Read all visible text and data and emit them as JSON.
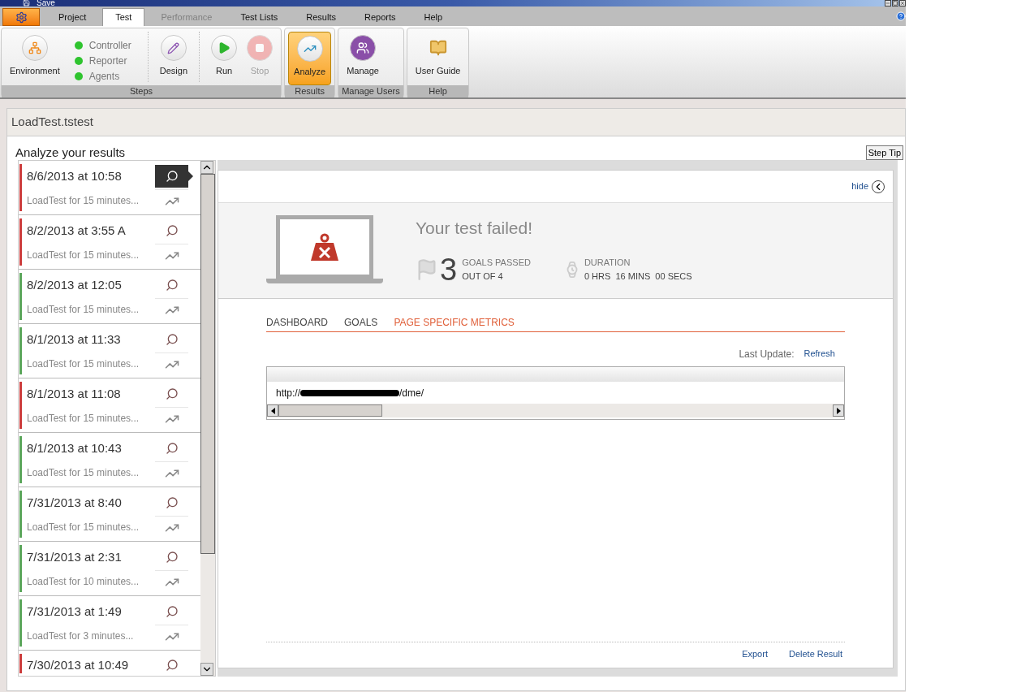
{
  "quick_access": {
    "label": "Save"
  },
  "menu_tabs": [
    {
      "label": "Project",
      "selected": false,
      "disabled": false
    },
    {
      "label": "Test",
      "selected": true,
      "disabled": false
    },
    {
      "label": "Performance",
      "selected": false,
      "disabled": true
    },
    {
      "label": "Test Lists",
      "selected": false,
      "disabled": false
    },
    {
      "label": "Results",
      "selected": false,
      "disabled": false
    },
    {
      "label": "Reports",
      "selected": false,
      "disabled": false
    },
    {
      "label": "Help",
      "selected": false,
      "disabled": false
    }
  ],
  "ribbon": {
    "groups": [
      {
        "label": "Steps",
        "items": [
          {
            "kind": "button",
            "label": "Environment",
            "selected": false,
            "disabled": false
          },
          {
            "kind": "status",
            "lights": [
              {
                "label": "Controller",
                "on": true
              },
              {
                "label": "Reporter",
                "on": true
              },
              {
                "label": "Agents",
                "on": true
              }
            ]
          },
          {
            "kind": "separator"
          },
          {
            "kind": "button",
            "label": "Design",
            "selected": false,
            "disabled": false
          },
          {
            "kind": "separator"
          },
          {
            "kind": "button",
            "label": "Run",
            "selected": false,
            "disabled": false
          },
          {
            "kind": "button",
            "label": "Stop",
            "selected": false,
            "disabled": true
          }
        ]
      },
      {
        "label": "Results",
        "items": [
          {
            "kind": "button",
            "label": "Analyze",
            "selected": true,
            "disabled": false
          }
        ]
      },
      {
        "label": "Manage Users",
        "items": [
          {
            "kind": "button",
            "label": "Manage",
            "selected": false,
            "disabled": false
          }
        ]
      },
      {
        "label": "Help",
        "items": [
          {
            "kind": "button",
            "label": "User Guide",
            "selected": false,
            "disabled": false
          }
        ]
      }
    ]
  },
  "document": {
    "title": "LoadTest.tstest",
    "heading": "Analyze your results",
    "step_tip": "Step Tip",
    "results": [
      {
        "date": "8/6/2013 at 10:58",
        "summary": "LoadTest for 15 minutes...",
        "color": "#cc3b3b",
        "selected": true
      },
      {
        "date": "8/2/2013 at 3:55 A",
        "summary": "LoadTest for 15 minutes...",
        "color": "#cc3b3b",
        "selected": false
      },
      {
        "date": "8/2/2013 at 12:05",
        "summary": "LoadTest for 15 minutes...",
        "color": "#5aa55a",
        "selected": false
      },
      {
        "date": "8/1/2013 at 11:33",
        "summary": "LoadTest for 15 minutes...",
        "color": "#5aa55a",
        "selected": false
      },
      {
        "date": "8/1/2013 at 11:08",
        "summary": "LoadTest for 15 minutes...",
        "color": "#cc3b3b",
        "selected": false
      },
      {
        "date": "8/1/2013 at 10:43",
        "summary": "LoadTest for 15 minutes...",
        "color": "#5aa55a",
        "selected": false
      },
      {
        "date": "7/31/2013 at 8:40",
        "summary": "LoadTest for 15 minutes...",
        "color": "#5aa55a",
        "selected": false
      },
      {
        "date": "7/31/2013 at 2:31",
        "summary": "LoadTest for 10 minutes...",
        "color": "#5aa55a",
        "selected": false
      },
      {
        "date": "7/31/2013 at 1:49",
        "summary": "LoadTest for 3 minutes...",
        "color": "#5aa55a",
        "selected": false
      },
      {
        "date": "7/30/2013 at 10:49",
        "color": "#cc3b3b",
        "selected": false
      }
    ],
    "detail": {
      "hide": "hide",
      "status": "Your test failed!",
      "failed": true,
      "goals": {
        "count": "3",
        "label": "GOALS PASSED",
        "sub": "OUT OF 4"
      },
      "duration": {
        "label": "DURATION",
        "value": "0 HRS  16 MINS  00 SECS"
      },
      "tabs": [
        {
          "label": "DASHBOARD",
          "selected": false
        },
        {
          "label": "GOALS",
          "selected": false
        },
        {
          "label": "PAGE SPECIFIC METRICS",
          "selected": true
        }
      ],
      "last_update": "Last Update:",
      "refresh": "Refresh",
      "url": {
        "prefix": "http://",
        "suffix": "/dme/"
      },
      "footer": [
        "Export",
        "Delete Result"
      ]
    }
  }
}
